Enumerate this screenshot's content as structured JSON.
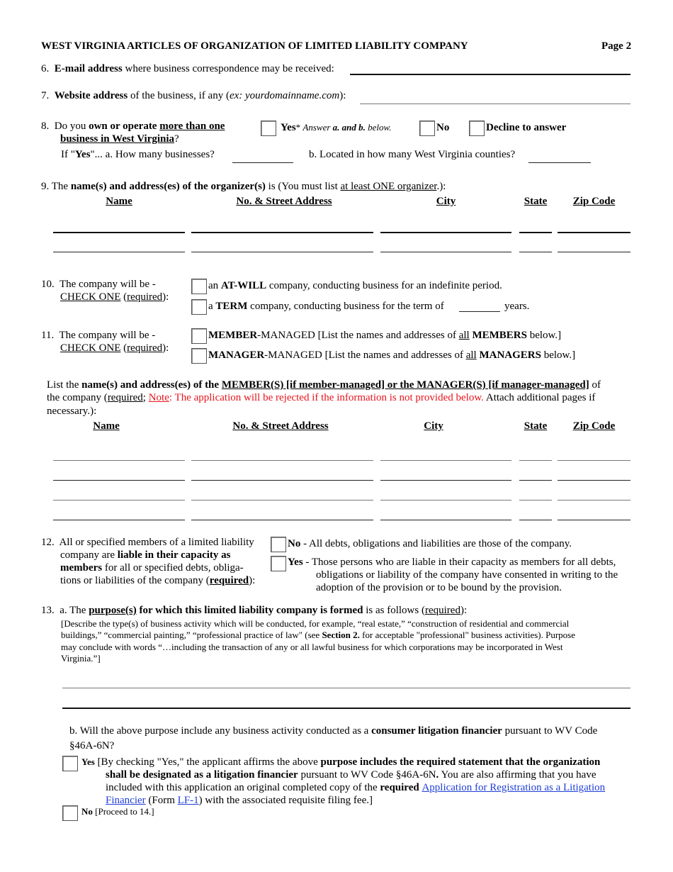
{
  "header": {
    "title": "WEST VIRGINIA ARTICLES OF ORGANIZATION OF LIMITED LIABILITY COMPANY",
    "page": "Page 2"
  },
  "q6": {
    "num": "6.",
    "bold": "E-mail address",
    "rest": " where business correspondence may be received:",
    "value": ""
  },
  "q7": {
    "num": "7.",
    "bold": "Website address",
    "rest1": " of the business, if any (",
    "example": "ex: yourdomainname.com",
    "rest2": "):",
    "value": ""
  },
  "q8": {
    "num": "8.",
    "pre": "Do you ",
    "bold1": "own or operate ",
    "bold_u1": "more than one",
    "bold_u2": "business in West Virginia",
    "end": "?",
    "yes_label": "Yes",
    "yes_note_star": "* ",
    "yes_note_1": "Answer ",
    "yes_note_bold": "a. and b.",
    "yes_note_2": " below.",
    "no_label": "No",
    "decline_label": "Decline to answer",
    "if_pre": "If \"",
    "if_bold": "Yes",
    "if_post": "\"... a.  How many businesses?",
    "b_label": "b.  Located in how many West Virginia counties?"
  },
  "q9": {
    "num": "9.",
    "pre": "The ",
    "bold": "name(s) and address(es) of the organizer(s)",
    "mid": " is (You must list ",
    "u": "at least ONE organizer",
    "end": ".):",
    "columns": [
      "Name",
      "No. & Street Address",
      "City",
      "State",
      "Zip Code"
    ],
    "rows": [
      [
        "",
        "",
        "",
        "",
        ""
      ],
      [
        "",
        "",
        "",
        "",
        ""
      ]
    ]
  },
  "q10": {
    "num": "10.",
    "line1": "The company will be -",
    "check_one": "CHECK ONE",
    "required": "required",
    "opt1_pre": "an ",
    "opt1_bold": "AT-WILL",
    "opt1_post": " company, conducting business for an indefinite period.",
    "opt2_pre": "a ",
    "opt2_bold": "TERM",
    "opt2_post": " company, conducting business for the term of",
    "opt2_years": "years.",
    "term_value": ""
  },
  "q11": {
    "num": "11.",
    "line1": "The company will be -",
    "check_one": "CHECK ONE",
    "required": "required",
    "opt1_bold": "MEMBER",
    "opt1_post": "-MANAGED [List the names and addresses of ",
    "opt1_u": "all",
    "opt1_bold2": " MEMBERS",
    "opt1_end": " below.]",
    "opt2_bold": "MANAGER",
    "opt2_post": "-MANAGED [List the names and addresses of ",
    "opt2_u": "all",
    "opt2_bold2": " MANAGERS",
    "opt2_end": " below.]"
  },
  "members": {
    "pre": "List the ",
    "bold": "name(s) and address(es) of the ",
    "bold_u": "MEMBER(S) [if member-managed] or the MANAGER(S) [if manager-managed]",
    "of": " of",
    "line2_pre": "the company (",
    "required": "required",
    "semi": "; ",
    "note": "Note",
    "note_text": ": The application will be rejected if the information is not provided below.",
    "attach": " Attach additional pages if",
    "line3": "necessary.):",
    "columns": [
      "Name",
      "No. & Street Address",
      "City",
      "State",
      "Zip Code"
    ],
    "rows": [
      [
        "",
        "",
        "",
        "",
        ""
      ],
      [
        "",
        "",
        "",
        "",
        ""
      ],
      [
        "",
        "",
        "",
        "",
        ""
      ],
      [
        "",
        "",
        "",
        "",
        ""
      ]
    ]
  },
  "q12": {
    "num": "12.",
    "l1": "All or specified members of a limited liability",
    "l2_pre": "company are ",
    "l2_bold": "liable in their capacity as",
    "l3_bold": "members",
    "l3_post": " for all or specified debts, obliga-",
    "l4_pre": "tions or liabilities of the company (",
    "l4_bold_u": "required",
    "l4_end": "):",
    "no_label": "No",
    "no_text": " -  All debts, obligations and liabilities are those of the company.",
    "yes_label": "Yes",
    "yes_text1": " - Those persons who are liable in their capacity as members for all debts,",
    "yes_text2": "obligations or liability of the company have consented in writing to the",
    "yes_text3": "adoption of the provision or to be bound by the provision."
  },
  "q13": {
    "num": "13.",
    "a_pre": "a.  The ",
    "a_bold_u": "purpose(s)",
    "a_bold": " for which this limited liability company is formed",
    "a_post": " is as follows (",
    "a_required": "required",
    "a_end": "):",
    "desc1": "[Describe the type(s) of business activity which will be conducted, for example, “real estate,” “construction of residential and commercial",
    "desc2_pre": "buildings,” “commercial painting,” “professional practice of law\" (see ",
    "desc2_bold": "Section 2.",
    "desc2_post": " for acceptable \"professional\" business activities). Purpose",
    "desc3": "may conclude with words “…including the transaction of any or all lawful business for which corporations may be incorporated in West",
    "desc4": "Virginia.”]",
    "purpose_value": "",
    "b_pre": "b. Will the above purpose include any business activity conducted as a ",
    "b_bold": "consumer litigation financier",
    "b_post": " pursuant to WV Code",
    "b_line2": "§46A-6N?",
    "yes_label": "Yes",
    "yes_t1_pre": " [By checking \"Yes,\" the applicant affirms the above ",
    "yes_t1_bold": "purpose includes the required statement that the organization",
    "yes_t2_bold": "shall be designated as a litigation financier",
    "yes_t2_post": " pursuant to WV Code §46A-6N",
    "yes_t2_dot": ".",
    "yes_t2_end": " You are also affirming that you have",
    "yes_t3_pre": "included with this application an original completed copy of the ",
    "yes_t3_bold": "required",
    "yes_t3_link": "Application for Registration as a Litigation",
    "yes_t4_link": "Financier",
    "yes_t4_mid": " (Form ",
    "yes_t4_link2": "LF-1",
    "yes_t4_end": ") with the associated requisite filing fee.]",
    "no_label": "No",
    "no_text": " [Proceed to 14.]"
  },
  "colors": {
    "note_red": "#e8141c",
    "link_blue": "#1f3fd6"
  }
}
